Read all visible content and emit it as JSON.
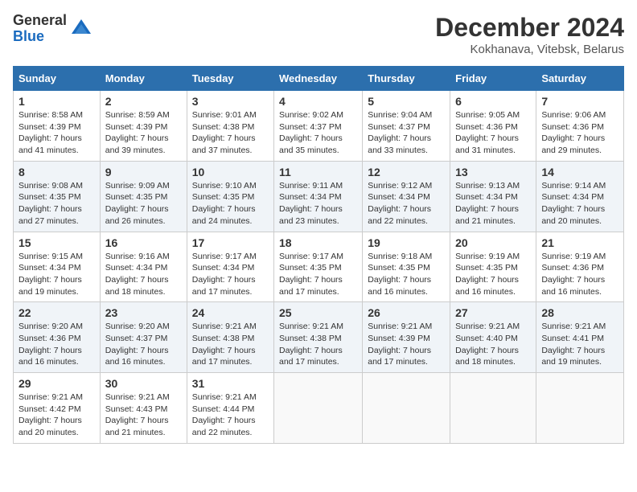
{
  "logo": {
    "general": "General",
    "blue": "Blue"
  },
  "header": {
    "month": "December 2024",
    "location": "Kokhanava, Vitebsk, Belarus"
  },
  "weekdays": [
    "Sunday",
    "Monday",
    "Tuesday",
    "Wednesday",
    "Thursday",
    "Friday",
    "Saturday"
  ],
  "weeks": [
    [
      {
        "day": "1",
        "sunrise": "Sunrise: 8:58 AM",
        "sunset": "Sunset: 4:39 PM",
        "daylight": "Daylight: 7 hours and 41 minutes."
      },
      {
        "day": "2",
        "sunrise": "Sunrise: 8:59 AM",
        "sunset": "Sunset: 4:39 PM",
        "daylight": "Daylight: 7 hours and 39 minutes."
      },
      {
        "day": "3",
        "sunrise": "Sunrise: 9:01 AM",
        "sunset": "Sunset: 4:38 PM",
        "daylight": "Daylight: 7 hours and 37 minutes."
      },
      {
        "day": "4",
        "sunrise": "Sunrise: 9:02 AM",
        "sunset": "Sunset: 4:37 PM",
        "daylight": "Daylight: 7 hours and 35 minutes."
      },
      {
        "day": "5",
        "sunrise": "Sunrise: 9:04 AM",
        "sunset": "Sunset: 4:37 PM",
        "daylight": "Daylight: 7 hours and 33 minutes."
      },
      {
        "day": "6",
        "sunrise": "Sunrise: 9:05 AM",
        "sunset": "Sunset: 4:36 PM",
        "daylight": "Daylight: 7 hours and 31 minutes."
      },
      {
        "day": "7",
        "sunrise": "Sunrise: 9:06 AM",
        "sunset": "Sunset: 4:36 PM",
        "daylight": "Daylight: 7 hours and 29 minutes."
      }
    ],
    [
      {
        "day": "8",
        "sunrise": "Sunrise: 9:08 AM",
        "sunset": "Sunset: 4:35 PM",
        "daylight": "Daylight: 7 hours and 27 minutes."
      },
      {
        "day": "9",
        "sunrise": "Sunrise: 9:09 AM",
        "sunset": "Sunset: 4:35 PM",
        "daylight": "Daylight: 7 hours and 26 minutes."
      },
      {
        "day": "10",
        "sunrise": "Sunrise: 9:10 AM",
        "sunset": "Sunset: 4:35 PM",
        "daylight": "Daylight: 7 hours and 24 minutes."
      },
      {
        "day": "11",
        "sunrise": "Sunrise: 9:11 AM",
        "sunset": "Sunset: 4:34 PM",
        "daylight": "Daylight: 7 hours and 23 minutes."
      },
      {
        "day": "12",
        "sunrise": "Sunrise: 9:12 AM",
        "sunset": "Sunset: 4:34 PM",
        "daylight": "Daylight: 7 hours and 22 minutes."
      },
      {
        "day": "13",
        "sunrise": "Sunrise: 9:13 AM",
        "sunset": "Sunset: 4:34 PM",
        "daylight": "Daylight: 7 hours and 21 minutes."
      },
      {
        "day": "14",
        "sunrise": "Sunrise: 9:14 AM",
        "sunset": "Sunset: 4:34 PM",
        "daylight": "Daylight: 7 hours and 20 minutes."
      }
    ],
    [
      {
        "day": "15",
        "sunrise": "Sunrise: 9:15 AM",
        "sunset": "Sunset: 4:34 PM",
        "daylight": "Daylight: 7 hours and 19 minutes."
      },
      {
        "day": "16",
        "sunrise": "Sunrise: 9:16 AM",
        "sunset": "Sunset: 4:34 PM",
        "daylight": "Daylight: 7 hours and 18 minutes."
      },
      {
        "day": "17",
        "sunrise": "Sunrise: 9:17 AM",
        "sunset": "Sunset: 4:34 PM",
        "daylight": "Daylight: 7 hours and 17 minutes."
      },
      {
        "day": "18",
        "sunrise": "Sunrise: 9:17 AM",
        "sunset": "Sunset: 4:35 PM",
        "daylight": "Daylight: 7 hours and 17 minutes."
      },
      {
        "day": "19",
        "sunrise": "Sunrise: 9:18 AM",
        "sunset": "Sunset: 4:35 PM",
        "daylight": "Daylight: 7 hours and 16 minutes."
      },
      {
        "day": "20",
        "sunrise": "Sunrise: 9:19 AM",
        "sunset": "Sunset: 4:35 PM",
        "daylight": "Daylight: 7 hours and 16 minutes."
      },
      {
        "day": "21",
        "sunrise": "Sunrise: 9:19 AM",
        "sunset": "Sunset: 4:36 PM",
        "daylight": "Daylight: 7 hours and 16 minutes."
      }
    ],
    [
      {
        "day": "22",
        "sunrise": "Sunrise: 9:20 AM",
        "sunset": "Sunset: 4:36 PM",
        "daylight": "Daylight: 7 hours and 16 minutes."
      },
      {
        "day": "23",
        "sunrise": "Sunrise: 9:20 AM",
        "sunset": "Sunset: 4:37 PM",
        "daylight": "Daylight: 7 hours and 16 minutes."
      },
      {
        "day": "24",
        "sunrise": "Sunrise: 9:21 AM",
        "sunset": "Sunset: 4:38 PM",
        "daylight": "Daylight: 7 hours and 17 minutes."
      },
      {
        "day": "25",
        "sunrise": "Sunrise: 9:21 AM",
        "sunset": "Sunset: 4:38 PM",
        "daylight": "Daylight: 7 hours and 17 minutes."
      },
      {
        "day": "26",
        "sunrise": "Sunrise: 9:21 AM",
        "sunset": "Sunset: 4:39 PM",
        "daylight": "Daylight: 7 hours and 17 minutes."
      },
      {
        "day": "27",
        "sunrise": "Sunrise: 9:21 AM",
        "sunset": "Sunset: 4:40 PM",
        "daylight": "Daylight: 7 hours and 18 minutes."
      },
      {
        "day": "28",
        "sunrise": "Sunrise: 9:21 AM",
        "sunset": "Sunset: 4:41 PM",
        "daylight": "Daylight: 7 hours and 19 minutes."
      }
    ],
    [
      {
        "day": "29",
        "sunrise": "Sunrise: 9:21 AM",
        "sunset": "Sunset: 4:42 PM",
        "daylight": "Daylight: 7 hours and 20 minutes."
      },
      {
        "day": "30",
        "sunrise": "Sunrise: 9:21 AM",
        "sunset": "Sunset: 4:43 PM",
        "daylight": "Daylight: 7 hours and 21 minutes."
      },
      {
        "day": "31",
        "sunrise": "Sunrise: 9:21 AM",
        "sunset": "Sunset: 4:44 PM",
        "daylight": "Daylight: 7 hours and 22 minutes."
      },
      null,
      null,
      null,
      null
    ]
  ]
}
